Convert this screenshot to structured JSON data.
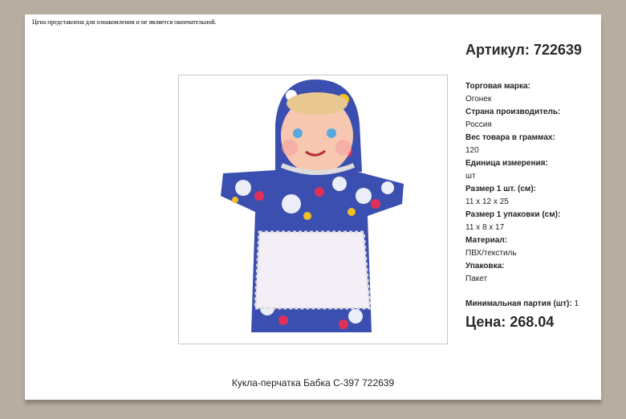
{
  "notice": "Цена представлена для ознакомления и не является окончательной.",
  "sku": "Артикул: 722639",
  "specs": [
    {
      "label": "Торговая марка:",
      "value": "Огонек"
    },
    {
      "label": "Страна производитель:",
      "value": "Россия"
    },
    {
      "label": "Вес товара в граммах:",
      "value": "120"
    },
    {
      "label": "Единица измерения:",
      "value": "шт"
    },
    {
      "label": "Размер 1 шт. (см):",
      "value": "11 x 12 x 25"
    },
    {
      "label": "Размер 1 упаковки (см):",
      "value": "11 x 8 x 17"
    },
    {
      "label": "Материал:",
      "value": "ПВХ/текстиль"
    },
    {
      "label": "Упаковка:",
      "value": "Пакет"
    }
  ],
  "min_order_label": "Минимальная партия (шт):",
  "min_order_value": "1",
  "price": "Цена: 268.04",
  "product_title": "Кукла-перчатка Бабка С-397 722639",
  "colors": {
    "background": "#b8ada1",
    "fabric": "#3b4fb0"
  }
}
